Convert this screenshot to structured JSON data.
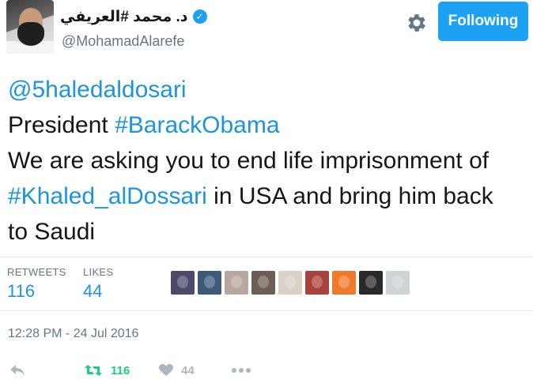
{
  "header": {
    "display_name": "د. محمد #العريفي",
    "verified_symbol": "✓",
    "handle": "@MohamadAlarefe",
    "follow_label": "Following",
    "accent_color": "#1da1f2"
  },
  "tweet": {
    "mention": "@5haledaldosari",
    "line2_prefix": "President ",
    "hashtag1": "#BarackObama",
    "line3": "We are asking you to end life imprisonment of",
    "hashtag2": "#Khaled_alDossari",
    "line4_suffix": " in USA and bring him back",
    "line5": "to Saudi"
  },
  "stats": {
    "retweets_label": "RETWEETS",
    "retweets_value": "116",
    "likes_label": "LIKES",
    "likes_value": "44",
    "liker_avatar_colors": [
      "#4b4a6b",
      "#3e5a78",
      "#b7a7a0",
      "#6d5d55",
      "#d9d0c6",
      "#a7423c",
      "#f07a2a",
      "#2a2a2a",
      "#cfd3d6"
    ]
  },
  "timestamp": "12:28 PM - 24 Jul 2016",
  "actions": {
    "reply_icon": "reply-icon",
    "retweet_icon": "retweet-icon",
    "retweet_count": "116",
    "like_icon": "heart-icon",
    "like_count": "44",
    "more_icon": "more-icon"
  }
}
